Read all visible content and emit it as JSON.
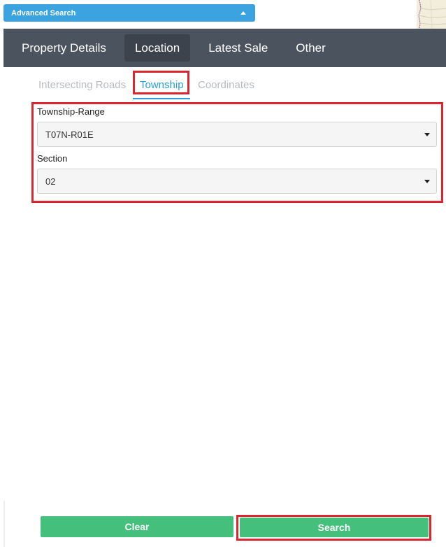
{
  "advanced_search": {
    "label": "Advanced Search",
    "icon": "caret-up-icon"
  },
  "main_tabs": [
    {
      "label": "Property Details",
      "active": false
    },
    {
      "label": "Location",
      "active": true
    },
    {
      "label": "Latest Sale",
      "active": false
    },
    {
      "label": "Other",
      "active": false
    }
  ],
  "sub_tabs": [
    {
      "label": "Intersecting Roads",
      "active": false
    },
    {
      "label": "Township",
      "active": true
    },
    {
      "label": "Coordinates",
      "active": false
    }
  ],
  "fields": {
    "township_range": {
      "label": "Township-Range",
      "value": "T07N-R01E"
    },
    "section": {
      "label": "Section",
      "value": "02"
    }
  },
  "buttons": {
    "clear": "Clear",
    "search": "Search"
  },
  "colors": {
    "accent_blue": "#3aa3e0",
    "tab_bar": "#4b535e",
    "active_subtab": "#2c9fd6",
    "button_green": "#45c07c",
    "highlight_red": "#d9262f"
  }
}
